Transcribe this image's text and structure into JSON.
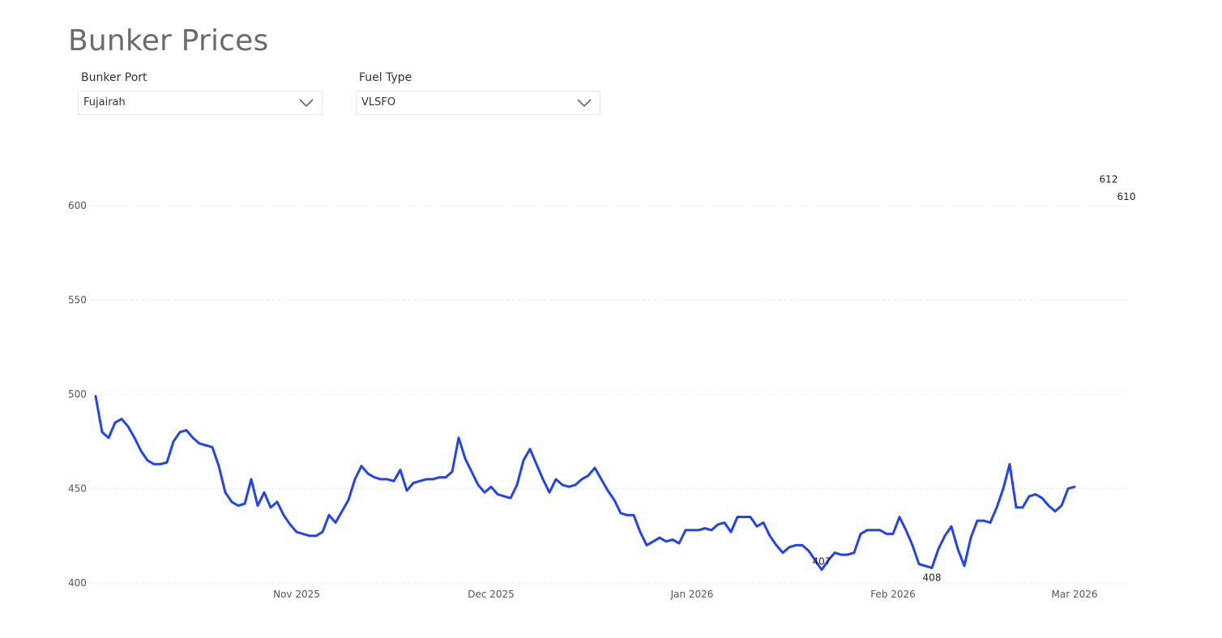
{
  "page": {
    "title": "Bunker Prices"
  },
  "filters": {
    "port": {
      "label": "Bunker Port",
      "value": "Fujairah"
    },
    "fuel": {
      "label": "Fuel Type",
      "value": "VLSFO"
    }
  },
  "colors": {
    "line": "#2343f0",
    "grid": "#d9d9d9",
    "title": "#6b6b6b"
  },
  "chart_data": {
    "type": "line",
    "title": "",
    "xlabel": "",
    "ylabel": "",
    "ylim": [
      400,
      625
    ],
    "yticks": [
      400,
      450,
      500,
      550,
      600
    ],
    "xlim": [
      "2025-10-01",
      "2026-03-09"
    ],
    "xticks": [
      {
        "date": "2025-11-01",
        "label": "Nov 2025"
      },
      {
        "date": "2025-12-01",
        "label": "Dec 2025"
      },
      {
        "date": "2026-01-01",
        "label": "Jan 2026"
      },
      {
        "date": "2026-02-01",
        "label": "Feb 2026"
      },
      {
        "date": "2026-03-01",
        "label": "Mar 2026"
      }
    ],
    "grid": true,
    "series": [
      {
        "points": [
          [
            "2025-10-01",
            499
          ],
          [
            "2025-10-02",
            480
          ],
          [
            "2025-10-03",
            477
          ],
          [
            "2025-10-04",
            485
          ],
          [
            "2025-10-05",
            487
          ],
          [
            "2025-10-06",
            483
          ],
          [
            "2025-10-07",
            477
          ],
          [
            "2025-10-08",
            470
          ],
          [
            "2025-10-09",
            465
          ],
          [
            "2025-10-10",
            463
          ],
          [
            "2025-10-11",
            463
          ],
          [
            "2025-10-12",
            464
          ],
          [
            "2025-10-13",
            475
          ],
          [
            "2025-10-14",
            480
          ],
          [
            "2025-10-15",
            481
          ],
          [
            "2025-10-16",
            477
          ],
          [
            "2025-10-17",
            474
          ],
          [
            "2025-10-18",
            473
          ],
          [
            "2025-10-19",
            472
          ],
          [
            "2025-10-20",
            462
          ],
          [
            "2025-10-21",
            448
          ],
          [
            "2025-10-22",
            443
          ],
          [
            "2025-10-23",
            441
          ],
          [
            "2025-10-24",
            442
          ],
          [
            "2025-10-25",
            455
          ],
          [
            "2025-10-26",
            441
          ],
          [
            "2025-10-27",
            448
          ],
          [
            "2025-10-28",
            440
          ],
          [
            "2025-10-29",
            443
          ],
          [
            "2025-10-30",
            436
          ],
          [
            "2025-10-31",
            431
          ],
          [
            "2025-11-01",
            427
          ],
          [
            "2025-11-02",
            426
          ],
          [
            "2025-11-03",
            425
          ],
          [
            "2025-11-04",
            425
          ],
          [
            "2025-11-05",
            427
          ],
          [
            "2025-11-06",
            436
          ],
          [
            "2025-11-07",
            432
          ],
          [
            "2025-11-08",
            438
          ],
          [
            "2025-11-09",
            444
          ],
          [
            "2025-11-10",
            455
          ],
          [
            "2025-11-11",
            462
          ],
          [
            "2025-11-12",
            458
          ],
          [
            "2025-11-13",
            456
          ],
          [
            "2025-11-14",
            455
          ],
          [
            "2025-11-15",
            455
          ],
          [
            "2025-11-16",
            454
          ],
          [
            "2025-11-17",
            460
          ],
          [
            "2025-11-18",
            449
          ],
          [
            "2025-11-19",
            453
          ],
          [
            "2025-11-20",
            454
          ],
          [
            "2025-11-21",
            455
          ],
          [
            "2025-11-22",
            455
          ],
          [
            "2025-11-23",
            456
          ],
          [
            "2025-11-24",
            456
          ],
          [
            "2025-11-25",
            459
          ],
          [
            "2025-11-26",
            477
          ],
          [
            "2025-11-27",
            466
          ],
          [
            "2025-11-28",
            459
          ],
          [
            "2025-11-29",
            452
          ],
          [
            "2025-11-30",
            448
          ],
          [
            "2025-12-01",
            451
          ],
          [
            "2025-12-02",
            447
          ],
          [
            "2025-12-03",
            446
          ],
          [
            "2025-12-04",
            445
          ],
          [
            "2025-12-05",
            452
          ],
          [
            "2025-12-06",
            465
          ],
          [
            "2025-12-07",
            471
          ],
          [
            "2025-12-08",
            463
          ],
          [
            "2025-12-09",
            455
          ],
          [
            "2025-12-10",
            448
          ],
          [
            "2025-12-11",
            455
          ],
          [
            "2025-12-12",
            452
          ],
          [
            "2025-12-13",
            451
          ],
          [
            "2025-12-14",
            452
          ],
          [
            "2025-12-15",
            455
          ],
          [
            "2025-12-16",
            457
          ],
          [
            "2025-12-17",
            461
          ],
          [
            "2025-12-18",
            455
          ],
          [
            "2025-12-19",
            449
          ],
          [
            "2025-12-20",
            444
          ],
          [
            "2025-12-21",
            437
          ],
          [
            "2025-12-22",
            436
          ],
          [
            "2025-12-23",
            436
          ],
          [
            "2025-12-24",
            427
          ],
          [
            "2025-12-25",
            420
          ],
          [
            "2025-12-26",
            422
          ],
          [
            "2025-12-27",
            424
          ],
          [
            "2025-12-28",
            422
          ],
          [
            "2025-12-29",
            423
          ],
          [
            "2025-12-30",
            421
          ],
          [
            "2025-12-31",
            428
          ],
          [
            "2026-01-01",
            428
          ],
          [
            "2026-01-02",
            428
          ],
          [
            "2026-01-03",
            429
          ],
          [
            "2026-01-04",
            428
          ],
          [
            "2026-01-05",
            431
          ],
          [
            "2026-01-06",
            432
          ],
          [
            "2026-01-07",
            427
          ],
          [
            "2026-01-08",
            435
          ],
          [
            "2026-01-09",
            435
          ],
          [
            "2026-01-10",
            435
          ],
          [
            "2026-01-11",
            430
          ],
          [
            "2026-01-12",
            432
          ],
          [
            "2026-01-13",
            425
          ],
          [
            "2026-01-14",
            420
          ],
          [
            "2026-01-15",
            416
          ],
          [
            "2026-01-16",
            419
          ],
          [
            "2026-01-17",
            420
          ],
          [
            "2026-01-18",
            420
          ],
          [
            "2026-01-19",
            417
          ],
          [
            "2026-01-20",
            412
          ],
          [
            "2026-01-21",
            407
          ],
          [
            "2026-01-22",
            412
          ],
          [
            "2026-01-23",
            416
          ],
          [
            "2026-01-24",
            415
          ],
          [
            "2026-01-25",
            415
          ],
          [
            "2026-01-26",
            416
          ],
          [
            "2026-01-27",
            426
          ],
          [
            "2026-01-28",
            428
          ],
          [
            "2026-01-29",
            428
          ],
          [
            "2026-01-30",
            428
          ],
          [
            "2026-01-31",
            426
          ],
          [
            "2026-02-01",
            426
          ],
          [
            "2026-02-02",
            435
          ],
          [
            "2026-02-03",
            428
          ],
          [
            "2026-02-04",
            420
          ],
          [
            "2026-02-05",
            410
          ],
          [
            "2026-02-06",
            409
          ],
          [
            "2026-02-07",
            408
          ],
          [
            "2026-02-08",
            418
          ],
          [
            "2026-02-09",
            425
          ],
          [
            "2026-02-10",
            430
          ],
          [
            "2026-02-11",
            418
          ],
          [
            "2026-02-12",
            409
          ],
          [
            "2026-02-13",
            424
          ],
          [
            "2026-02-14",
            433
          ],
          [
            "2026-02-15",
            433
          ],
          [
            "2026-02-16",
            432
          ],
          [
            "2026-02-17",
            440
          ],
          [
            "2026-02-18",
            450
          ],
          [
            "2026-02-19",
            463
          ],
          [
            "2026-02-20",
            440
          ],
          [
            "2026-02-21",
            440
          ],
          [
            "2026-02-22",
            446
          ],
          [
            "2026-02-23",
            447
          ],
          [
            "2026-02-24",
            445
          ],
          [
            "2026-02-25",
            441
          ],
          [
            "2026-02-26",
            438
          ],
          [
            "2026-02-27",
            441
          ],
          [
            "2026-02-28",
            450
          ],
          [
            "2026-03-01",
            451
          ]
        ]
      }
    ],
    "annotations": [
      {
        "label": "407",
        "date": "2026-01-21",
        "value": 407
      },
      {
        "label": "408",
        "date": "2026-02-07",
        "value": 408
      },
      {
        "label": "612",
        "date": "2026-03-08",
        "value": 612
      },
      {
        "label": "610",
        "date": "2026-03-08",
        "value": 610
      }
    ]
  }
}
